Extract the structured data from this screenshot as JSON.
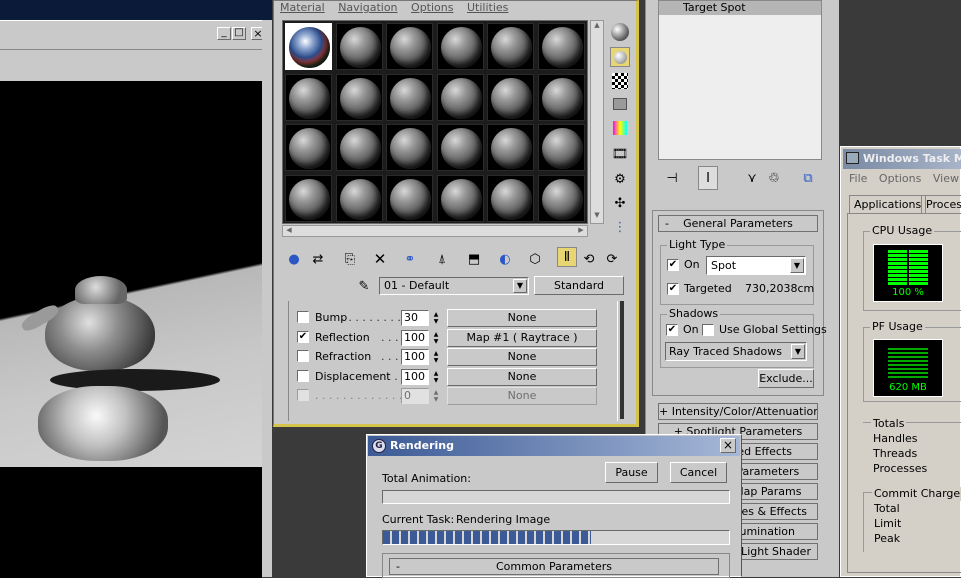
{
  "material_editor": {
    "menu": [
      "Material",
      "Navigation",
      "Options",
      "Utilities"
    ],
    "material_name": "01 - Default",
    "material_type": "Standard",
    "maps": [
      {
        "checked": false,
        "label": "Bump",
        "dots": " . . . . . . . . . .",
        "amount": "30",
        "map": "None"
      },
      {
        "checked": true,
        "label": "Reflection",
        "dots": " . . . . .",
        "amount": "100",
        "map": "Map #1  ( Raytrace )"
      },
      {
        "checked": false,
        "label": "Refraction",
        "dots": " . . . . .",
        "amount": "100",
        "map": "None"
      },
      {
        "checked": false,
        "label": "Displacement",
        "dots": " . . .",
        "amount": "100",
        "map": "None"
      },
      {
        "checked": false,
        "label": "",
        "dots": " . . . . . . . . . . . . .",
        "amount": "0",
        "map": "None"
      }
    ]
  },
  "viewport": {
    "window_buttons": [
      "_",
      "□",
      "×"
    ]
  },
  "light_panel": {
    "selected_object": "Target Spot",
    "general_parameters": "General Parameters",
    "light_type_label": "Light Type",
    "on_label": "On",
    "light_type_value": "Spot",
    "targeted_label": "Targeted",
    "target_distance": "730,2038cm",
    "shadows_label": "Shadows",
    "shadows_on_label": "On",
    "use_global_label": "Use Global Settings",
    "shadow_type": "Ray Traced Shadows",
    "exclude_label": "Exclude...",
    "rollouts": [
      "+ Intensity/Color/Attenuation",
      "+ Spotlight Parameters",
      "+ Advanced Effects",
      "+ Shadow Parameters",
      "+ Shadow Map Params",
      "+ Atmospheres & Effects",
      "+ Direct Illumination",
      "+ mental ray Light Shader"
    ]
  },
  "rendering": {
    "title": "Rendering",
    "close": "×",
    "total_animation_label": "Total Animation:",
    "pause_label": "Pause",
    "cancel_label": "Cancel",
    "current_task_label": "Current Task:",
    "current_task_value": "Rendering Image",
    "progress_fraction": 0.6,
    "common_parameters": "Common Parameters",
    "collapse_sign": "-"
  },
  "task_manager": {
    "title": "Windows Task Ma",
    "menu": [
      "File",
      "Options",
      "View"
    ],
    "tabs": [
      "Applications",
      "Process"
    ],
    "cpu_usage_label": "CPU Usage",
    "cpu_value": "100 %",
    "pf_usage_label": "PF Usage",
    "pf_value": "620 MB",
    "totals_label": "Totals",
    "totals_rows": [
      "Handles",
      "Threads",
      "Processes"
    ],
    "commit_label": "Commit Charge (K)",
    "commit_rows": [
      "Total",
      "Limit",
      "Peak"
    ]
  },
  "colors": {
    "accent": "#3c5a95",
    "title_bar": "#0a246a",
    "meter_green": "#00ff00"
  }
}
